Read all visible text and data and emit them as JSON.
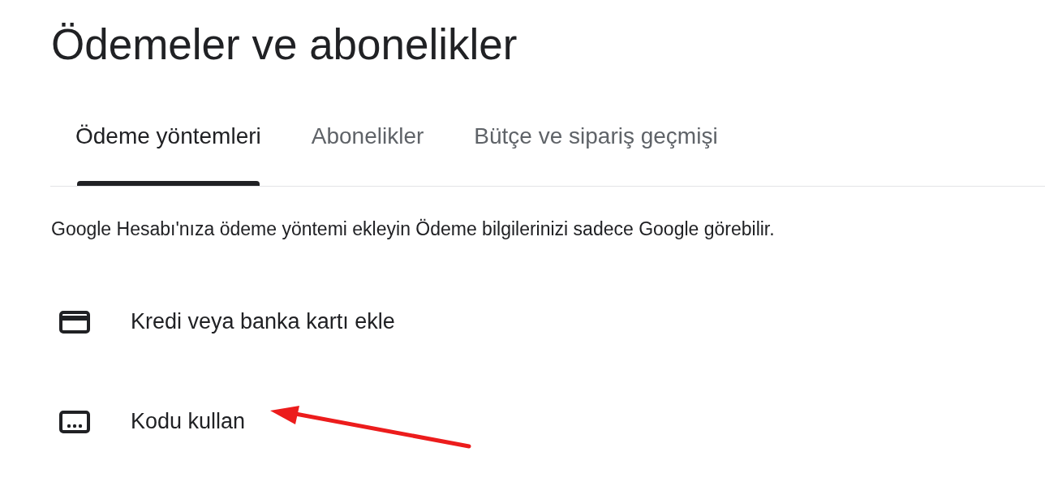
{
  "title": "Ödemeler ve abonelikler",
  "tabs": [
    {
      "label": "Ödeme yöntemleri",
      "selected": true
    },
    {
      "label": "Abonelikler",
      "selected": false
    },
    {
      "label": "Bütçe ve sipariş geçmişi",
      "selected": false
    }
  ],
  "description": "Google Hesabı'nıza ödeme yöntemi ekleyin Ödeme bilgilerinizi sadece Google görebilir.",
  "options": [
    {
      "kind": "card",
      "label": "Kredi veya banka kartı ekle"
    },
    {
      "kind": "code",
      "label": "Kodu kullan"
    }
  ]
}
